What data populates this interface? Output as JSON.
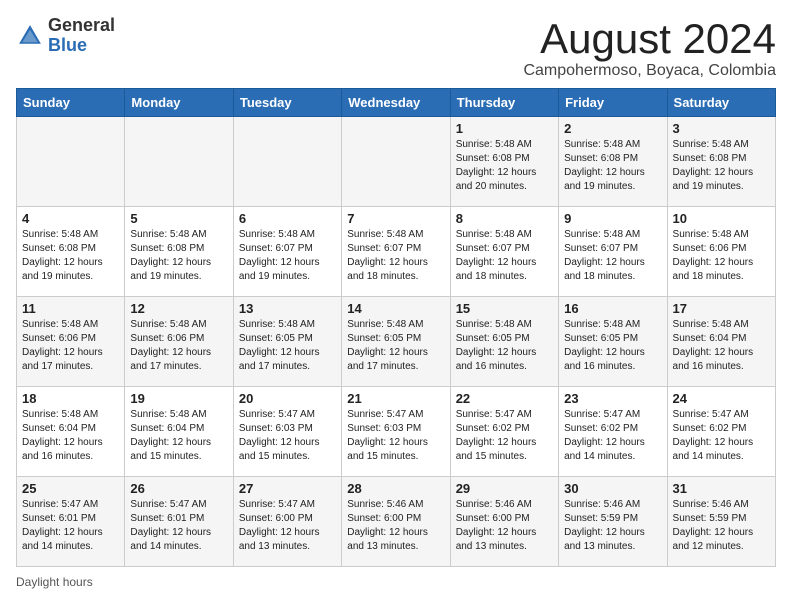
{
  "header": {
    "logo_general": "General",
    "logo_blue": "Blue",
    "month_title": "August 2024",
    "subtitle": "Campohermoso, Boyaca, Colombia"
  },
  "calendar": {
    "days_of_week": [
      "Sunday",
      "Monday",
      "Tuesday",
      "Wednesday",
      "Thursday",
      "Friday",
      "Saturday"
    ],
    "weeks": [
      [
        {
          "day": "",
          "info": ""
        },
        {
          "day": "",
          "info": ""
        },
        {
          "day": "",
          "info": ""
        },
        {
          "day": "",
          "info": ""
        },
        {
          "day": "1",
          "info": "Sunrise: 5:48 AM\nSunset: 6:08 PM\nDaylight: 12 hours and 20 minutes."
        },
        {
          "day": "2",
          "info": "Sunrise: 5:48 AM\nSunset: 6:08 PM\nDaylight: 12 hours and 19 minutes."
        },
        {
          "day": "3",
          "info": "Sunrise: 5:48 AM\nSunset: 6:08 PM\nDaylight: 12 hours and 19 minutes."
        }
      ],
      [
        {
          "day": "4",
          "info": "Sunrise: 5:48 AM\nSunset: 6:08 PM\nDaylight: 12 hours and 19 minutes."
        },
        {
          "day": "5",
          "info": "Sunrise: 5:48 AM\nSunset: 6:08 PM\nDaylight: 12 hours and 19 minutes."
        },
        {
          "day": "6",
          "info": "Sunrise: 5:48 AM\nSunset: 6:07 PM\nDaylight: 12 hours and 19 minutes."
        },
        {
          "day": "7",
          "info": "Sunrise: 5:48 AM\nSunset: 6:07 PM\nDaylight: 12 hours and 18 minutes."
        },
        {
          "day": "8",
          "info": "Sunrise: 5:48 AM\nSunset: 6:07 PM\nDaylight: 12 hours and 18 minutes."
        },
        {
          "day": "9",
          "info": "Sunrise: 5:48 AM\nSunset: 6:07 PM\nDaylight: 12 hours and 18 minutes."
        },
        {
          "day": "10",
          "info": "Sunrise: 5:48 AM\nSunset: 6:06 PM\nDaylight: 12 hours and 18 minutes."
        }
      ],
      [
        {
          "day": "11",
          "info": "Sunrise: 5:48 AM\nSunset: 6:06 PM\nDaylight: 12 hours and 17 minutes."
        },
        {
          "day": "12",
          "info": "Sunrise: 5:48 AM\nSunset: 6:06 PM\nDaylight: 12 hours and 17 minutes."
        },
        {
          "day": "13",
          "info": "Sunrise: 5:48 AM\nSunset: 6:05 PM\nDaylight: 12 hours and 17 minutes."
        },
        {
          "day": "14",
          "info": "Sunrise: 5:48 AM\nSunset: 6:05 PM\nDaylight: 12 hours and 17 minutes."
        },
        {
          "day": "15",
          "info": "Sunrise: 5:48 AM\nSunset: 6:05 PM\nDaylight: 12 hours and 16 minutes."
        },
        {
          "day": "16",
          "info": "Sunrise: 5:48 AM\nSunset: 6:05 PM\nDaylight: 12 hours and 16 minutes."
        },
        {
          "day": "17",
          "info": "Sunrise: 5:48 AM\nSunset: 6:04 PM\nDaylight: 12 hours and 16 minutes."
        }
      ],
      [
        {
          "day": "18",
          "info": "Sunrise: 5:48 AM\nSunset: 6:04 PM\nDaylight: 12 hours and 16 minutes."
        },
        {
          "day": "19",
          "info": "Sunrise: 5:48 AM\nSunset: 6:04 PM\nDaylight: 12 hours and 15 minutes."
        },
        {
          "day": "20",
          "info": "Sunrise: 5:47 AM\nSunset: 6:03 PM\nDaylight: 12 hours and 15 minutes."
        },
        {
          "day": "21",
          "info": "Sunrise: 5:47 AM\nSunset: 6:03 PM\nDaylight: 12 hours and 15 minutes."
        },
        {
          "day": "22",
          "info": "Sunrise: 5:47 AM\nSunset: 6:02 PM\nDaylight: 12 hours and 15 minutes."
        },
        {
          "day": "23",
          "info": "Sunrise: 5:47 AM\nSunset: 6:02 PM\nDaylight: 12 hours and 14 minutes."
        },
        {
          "day": "24",
          "info": "Sunrise: 5:47 AM\nSunset: 6:02 PM\nDaylight: 12 hours and 14 minutes."
        }
      ],
      [
        {
          "day": "25",
          "info": "Sunrise: 5:47 AM\nSunset: 6:01 PM\nDaylight: 12 hours and 14 minutes."
        },
        {
          "day": "26",
          "info": "Sunrise: 5:47 AM\nSunset: 6:01 PM\nDaylight: 12 hours and 14 minutes."
        },
        {
          "day": "27",
          "info": "Sunrise: 5:47 AM\nSunset: 6:00 PM\nDaylight: 12 hours and 13 minutes."
        },
        {
          "day": "28",
          "info": "Sunrise: 5:46 AM\nSunset: 6:00 PM\nDaylight: 12 hours and 13 minutes."
        },
        {
          "day": "29",
          "info": "Sunrise: 5:46 AM\nSunset: 6:00 PM\nDaylight: 12 hours and 13 minutes."
        },
        {
          "day": "30",
          "info": "Sunrise: 5:46 AM\nSunset: 5:59 PM\nDaylight: 12 hours and 13 minutes."
        },
        {
          "day": "31",
          "info": "Sunrise: 5:46 AM\nSunset: 5:59 PM\nDaylight: 12 hours and 12 minutes."
        }
      ]
    ]
  },
  "footer": {
    "daylight_label": "Daylight hours"
  }
}
